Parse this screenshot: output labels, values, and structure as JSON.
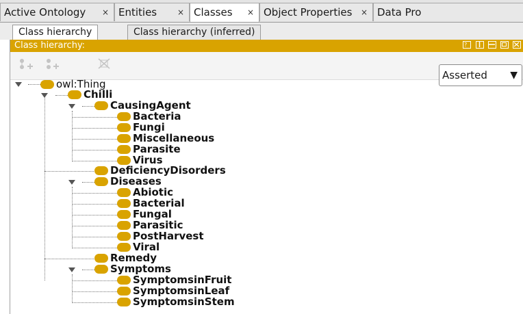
{
  "tabs": [
    {
      "label": "Active Ontology",
      "close": "×"
    },
    {
      "label": "Entities",
      "close": "×"
    },
    {
      "label": "Classes",
      "close": "×"
    },
    {
      "label": "Object Properties",
      "close": "×"
    },
    {
      "label": "Data Pro",
      "close": ""
    }
  ],
  "subtabs": [
    "Class hierarchy",
    "Class hierarchy (inferred)"
  ],
  "panel": {
    "title": "Class hierarchy:",
    "icons": [
      "help-icon",
      "split-horizontal-icon",
      "split-vertical-icon",
      "maximize-icon",
      "close-icon"
    ]
  },
  "toolbar": {
    "add_subclass_icon": "add-subclass-icon",
    "add_sibling_icon": "add-sibling-icon",
    "delete_icon": "delete-class-icon",
    "view_mode": "Asserted"
  },
  "tree": {
    "root": "owl:Thing",
    "chilli": "Chilli",
    "causing_agent": "CausingAgent",
    "bacteria": "Bacteria",
    "fungi": "Fungi",
    "miscellaneous": "Miscellaneous",
    "parasite": "Parasite",
    "virus": "Virus",
    "deficiency": "DeficiencyDisorders",
    "diseases": "Diseases",
    "abiotic": "Abiotic",
    "bacterial": "Bacterial",
    "fungal": "Fungal",
    "parasitic": "Parasitic",
    "postharvest": "PostHarvest",
    "viral": "Viral",
    "remedy": "Remedy",
    "symptoms": "Symptoms",
    "fruit": "SymptomsinFruit",
    "leaf": "SymptomsinLeaf",
    "stem": "SymptomsinStem"
  },
  "colors": {
    "accent": "#d9a300",
    "class_dot": "#d9a300"
  }
}
